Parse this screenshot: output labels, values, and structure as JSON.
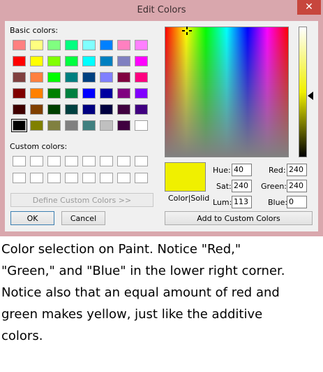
{
  "window": {
    "title": "Edit Colors",
    "close_glyph": "✕"
  },
  "labels": {
    "basic_colors": "Basic colors:",
    "custom_colors": "Custom colors:",
    "color_solid": "Color|Solid",
    "hue": "Hue:",
    "sat": "Sat:",
    "lum": "Lum:",
    "red": "Red:",
    "green": "Green:",
    "blue": "Blue:"
  },
  "values": {
    "hue": "40",
    "sat": "240",
    "lum": "113",
    "red": "240",
    "green": "240",
    "blue": "0"
  },
  "buttons": {
    "define_custom": "Define Custom Colors >>",
    "ok": "OK",
    "cancel": "Cancel",
    "add_custom": "Add to Custom Colors"
  },
  "basic_palette": [
    [
      "#ff8080",
      "#ffff80",
      "#80ff80",
      "#00ff80",
      "#80ffff",
      "#0080ff",
      "#ff80c0",
      "#ff80ff"
    ],
    [
      "#ff0000",
      "#ffff00",
      "#80ff00",
      "#00ff40",
      "#00ffff",
      "#0080c0",
      "#8080c0",
      "#ff00ff"
    ],
    [
      "#804040",
      "#ff8040",
      "#00ff00",
      "#008080",
      "#004080",
      "#8080ff",
      "#800040",
      "#ff0080"
    ],
    [
      "#800000",
      "#ff8000",
      "#008000",
      "#008040",
      "#0000ff",
      "#0000a0",
      "#800080",
      "#8000ff"
    ],
    [
      "#400000",
      "#804000",
      "#004000",
      "#004040",
      "#000080",
      "#000040",
      "#400040",
      "#400080"
    ],
    [
      "#000000",
      "#808000",
      "#808040",
      "#808080",
      "#408080",
      "#c0c0c0",
      "#400040",
      "#ffffff"
    ]
  ],
  "selected_color": "#f0f000",
  "caption": [
    "Color selection on Paint. Notice \"Red,\"",
    "\"Green,\" and \"Blue\" in the lower right corner.",
    "Notice also that an equal amount of red and",
    "green makes yellow, just like the additive",
    "colors."
  ]
}
